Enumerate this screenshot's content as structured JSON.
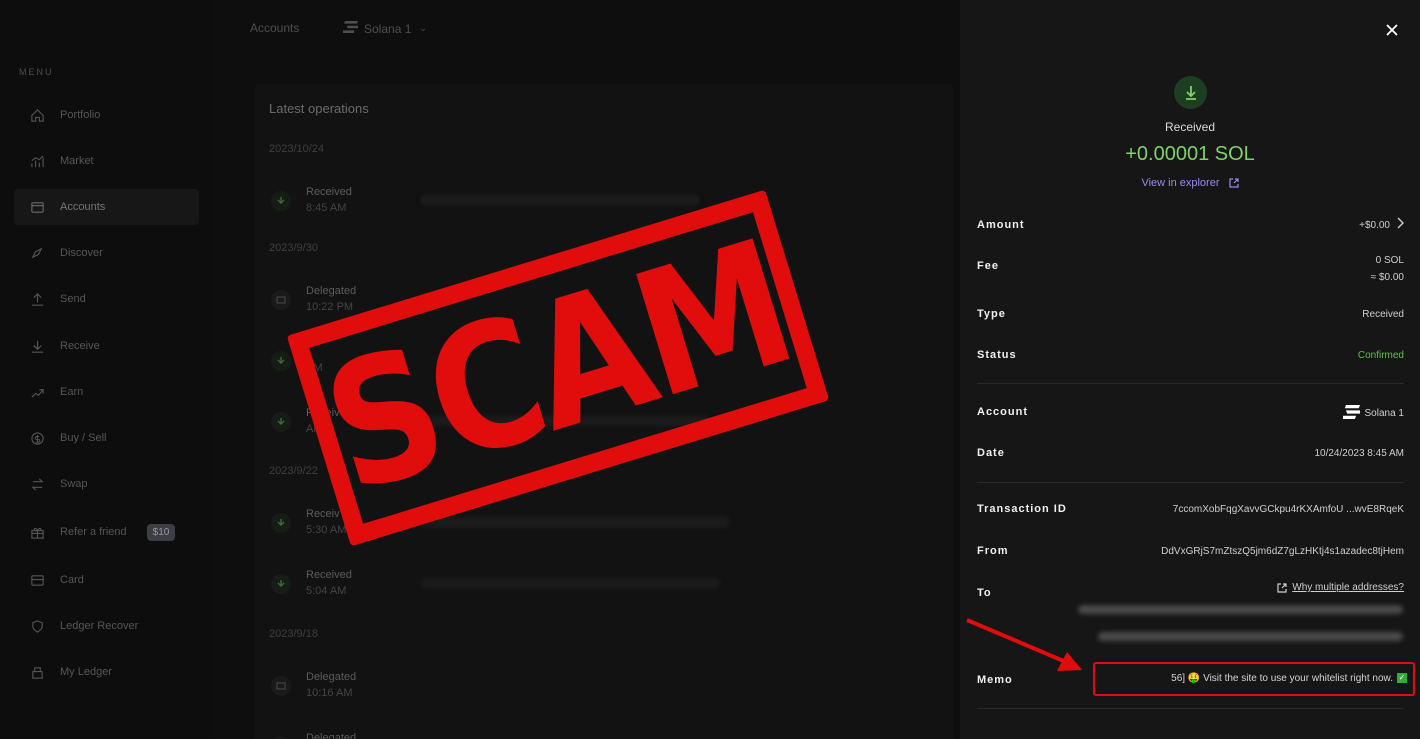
{
  "sidebar": {
    "menu_title": "MENU",
    "items": [
      {
        "label": "Portfolio",
        "icon": "home-icon"
      },
      {
        "label": "Market",
        "icon": "chart-icon"
      },
      {
        "label": "Accounts",
        "icon": "wallet-icon",
        "active": true
      },
      {
        "label": "Discover",
        "icon": "compass-icon"
      },
      {
        "label": "Send",
        "icon": "upload-icon"
      },
      {
        "label": "Receive",
        "icon": "download-icon"
      },
      {
        "label": "Earn",
        "icon": "growth-icon"
      },
      {
        "label": "Buy / Sell",
        "icon": "dollar-icon"
      },
      {
        "label": "Swap",
        "icon": "swap-icon"
      },
      {
        "label": "Refer a friend",
        "icon": "gift-icon",
        "badge": "$10"
      },
      {
        "label": "Card",
        "icon": "card-icon"
      },
      {
        "label": "Ledger Recover",
        "icon": "shield-icon"
      },
      {
        "label": "My Ledger",
        "icon": "device-icon"
      }
    ]
  },
  "breadcrumb": {
    "accounts": "Accounts",
    "account": "Solana 1"
  },
  "operations": {
    "title": "Latest operations",
    "groups": [
      {
        "date": "2023/10/24",
        "rows": [
          {
            "type": "Received",
            "time": "8:45 AM"
          }
        ]
      },
      {
        "date": "2023/9/30",
        "rows": [
          {
            "type": "Delegated",
            "time": "10:22 PM"
          },
          {
            "type": "",
            "time": "PM"
          },
          {
            "type": "Received",
            "time": "AM"
          }
        ]
      },
      {
        "date": "2023/9/22",
        "rows": [
          {
            "type": "Receiv",
            "time": "5:30 AM"
          },
          {
            "type": "Received",
            "time": "5:04 AM"
          }
        ]
      },
      {
        "date": "2023/9/18",
        "rows": [
          {
            "type": "Delegated",
            "time": "10:16 AM"
          },
          {
            "type": "Delegated",
            "time": ""
          }
        ]
      }
    ]
  },
  "stamp": {
    "text": "SCAM",
    "color": "#e10c0c"
  },
  "details": {
    "status_title": "Received",
    "amount": "+0.00001 SOL",
    "explorer_link": "View in explorer",
    "fields": {
      "amount_label": "Amount",
      "amount_value": "+$0.00",
      "fee_label": "Fee",
      "fee_value_1": "0 SOL",
      "fee_value_2": "≈ $0.00",
      "type_label": "Type",
      "type_value": "Received",
      "status_label": "Status",
      "status_value": "Confirmed",
      "account_label": "Account",
      "account_value": "Solana 1",
      "date_label": "Date",
      "date_value": "10/24/2023 8:45 AM",
      "txid_label": "Transaction ID",
      "txid_value": "7ccomXobFqgXavvGCkpu4rKXAmfoU ...wvE8RqeK",
      "from_label": "From",
      "from_value": "DdVxGRjS7mZtszQ5jm6dZ7gLzHKtj4s1azadec8tjHem",
      "to_label": "To",
      "to_link": "Why multiple addresses?",
      "memo_label": "Memo",
      "memo_value": "56] 🤑 Visit the site to use your whitelist right now."
    }
  },
  "colors": {
    "accent_green": "#7fd26b",
    "link_purple": "#9b88ee",
    "alert_red": "#e00d0d"
  }
}
